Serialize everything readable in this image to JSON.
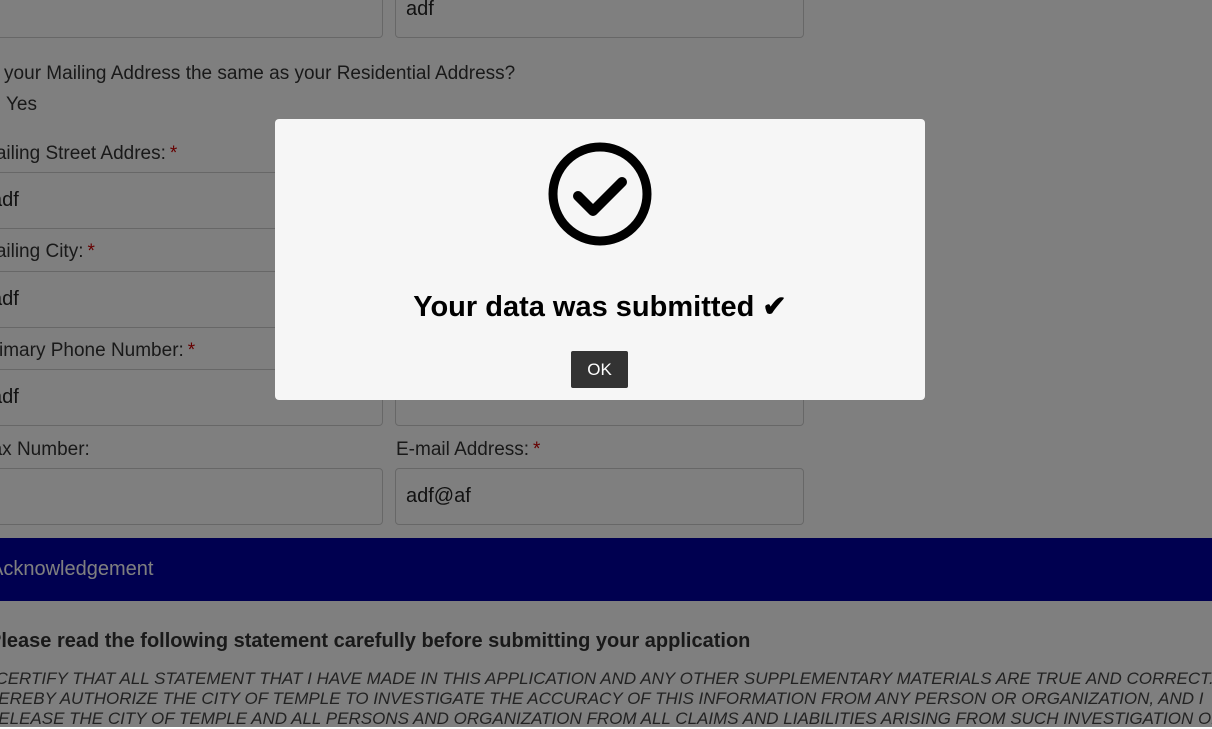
{
  "form": {
    "top_right_value": "adf",
    "mailing_question": "Is your Mailing Address the same as your Residential Address?",
    "mailing_yes_label": "Yes",
    "mailing_street": {
      "label": "Mailing Street Addres:",
      "required": "*",
      "value": "adf"
    },
    "mailing_city": {
      "label": "Mailing City:",
      "required": "*",
      "value": "adf"
    },
    "primary_phone": {
      "label": "Primary Phone Number:",
      "required": "*",
      "value": "adf"
    },
    "fax": {
      "label": "Fax Number:",
      "value": ""
    },
    "email": {
      "label": "E-mail Address:",
      "required": "*",
      "value": "adf@af"
    }
  },
  "acknowledgement": {
    "section_title": "Acknowledgement",
    "heading": "Please read the following statement carefully before submitting your application",
    "lines": [
      "I CERTIFY THAT ALL STATEMENT THAT I HAVE MADE IN THIS APPLICATION AND ANY OTHER SUPPLEMENTARY MATERIALS ARE TRUE AND CORRECT. I",
      "HEREBY AUTHORIZE THE CITY OF TEMPLE TO INVESTIGATE THE ACCURACY OF THIS INFORMATION FROM ANY PERSON OR ORGANIZATION, AND I",
      "RELEASE THE CITY OF TEMPLE AND ALL PERSONS AND ORGANIZATION FROM ALL CLAIMS AND LIABILITIES ARISING FROM SUCH INVESTIGATION OR"
    ]
  },
  "modal": {
    "icon": "check-circle-icon",
    "title": "Your data was submitted ✔",
    "ok_label": "OK"
  }
}
